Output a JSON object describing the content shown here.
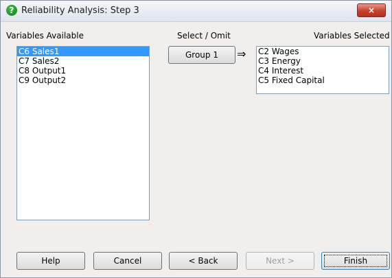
{
  "window": {
    "title": "Reliability Analysis: Step 3",
    "close_symbol": "×"
  },
  "available": {
    "label": "Variables Available",
    "items": [
      "C6 Sales1",
      "C7 Sales2",
      "C8 Output1",
      "C9 Output2"
    ],
    "selected_index": 0
  },
  "select_omit": {
    "label": "Select / Omit",
    "group_button": "Group 1",
    "arrow_symbol": "⇒"
  },
  "selected": {
    "label": "Variables Selected",
    "items": [
      "C2 Wages",
      "C3 Energy",
      "C4 Interest",
      "C5 Fixed Capital"
    ]
  },
  "buttons": {
    "help": "Help",
    "cancel": "Cancel",
    "back": "< Back",
    "next": "Next >",
    "finish": "Finish"
  }
}
